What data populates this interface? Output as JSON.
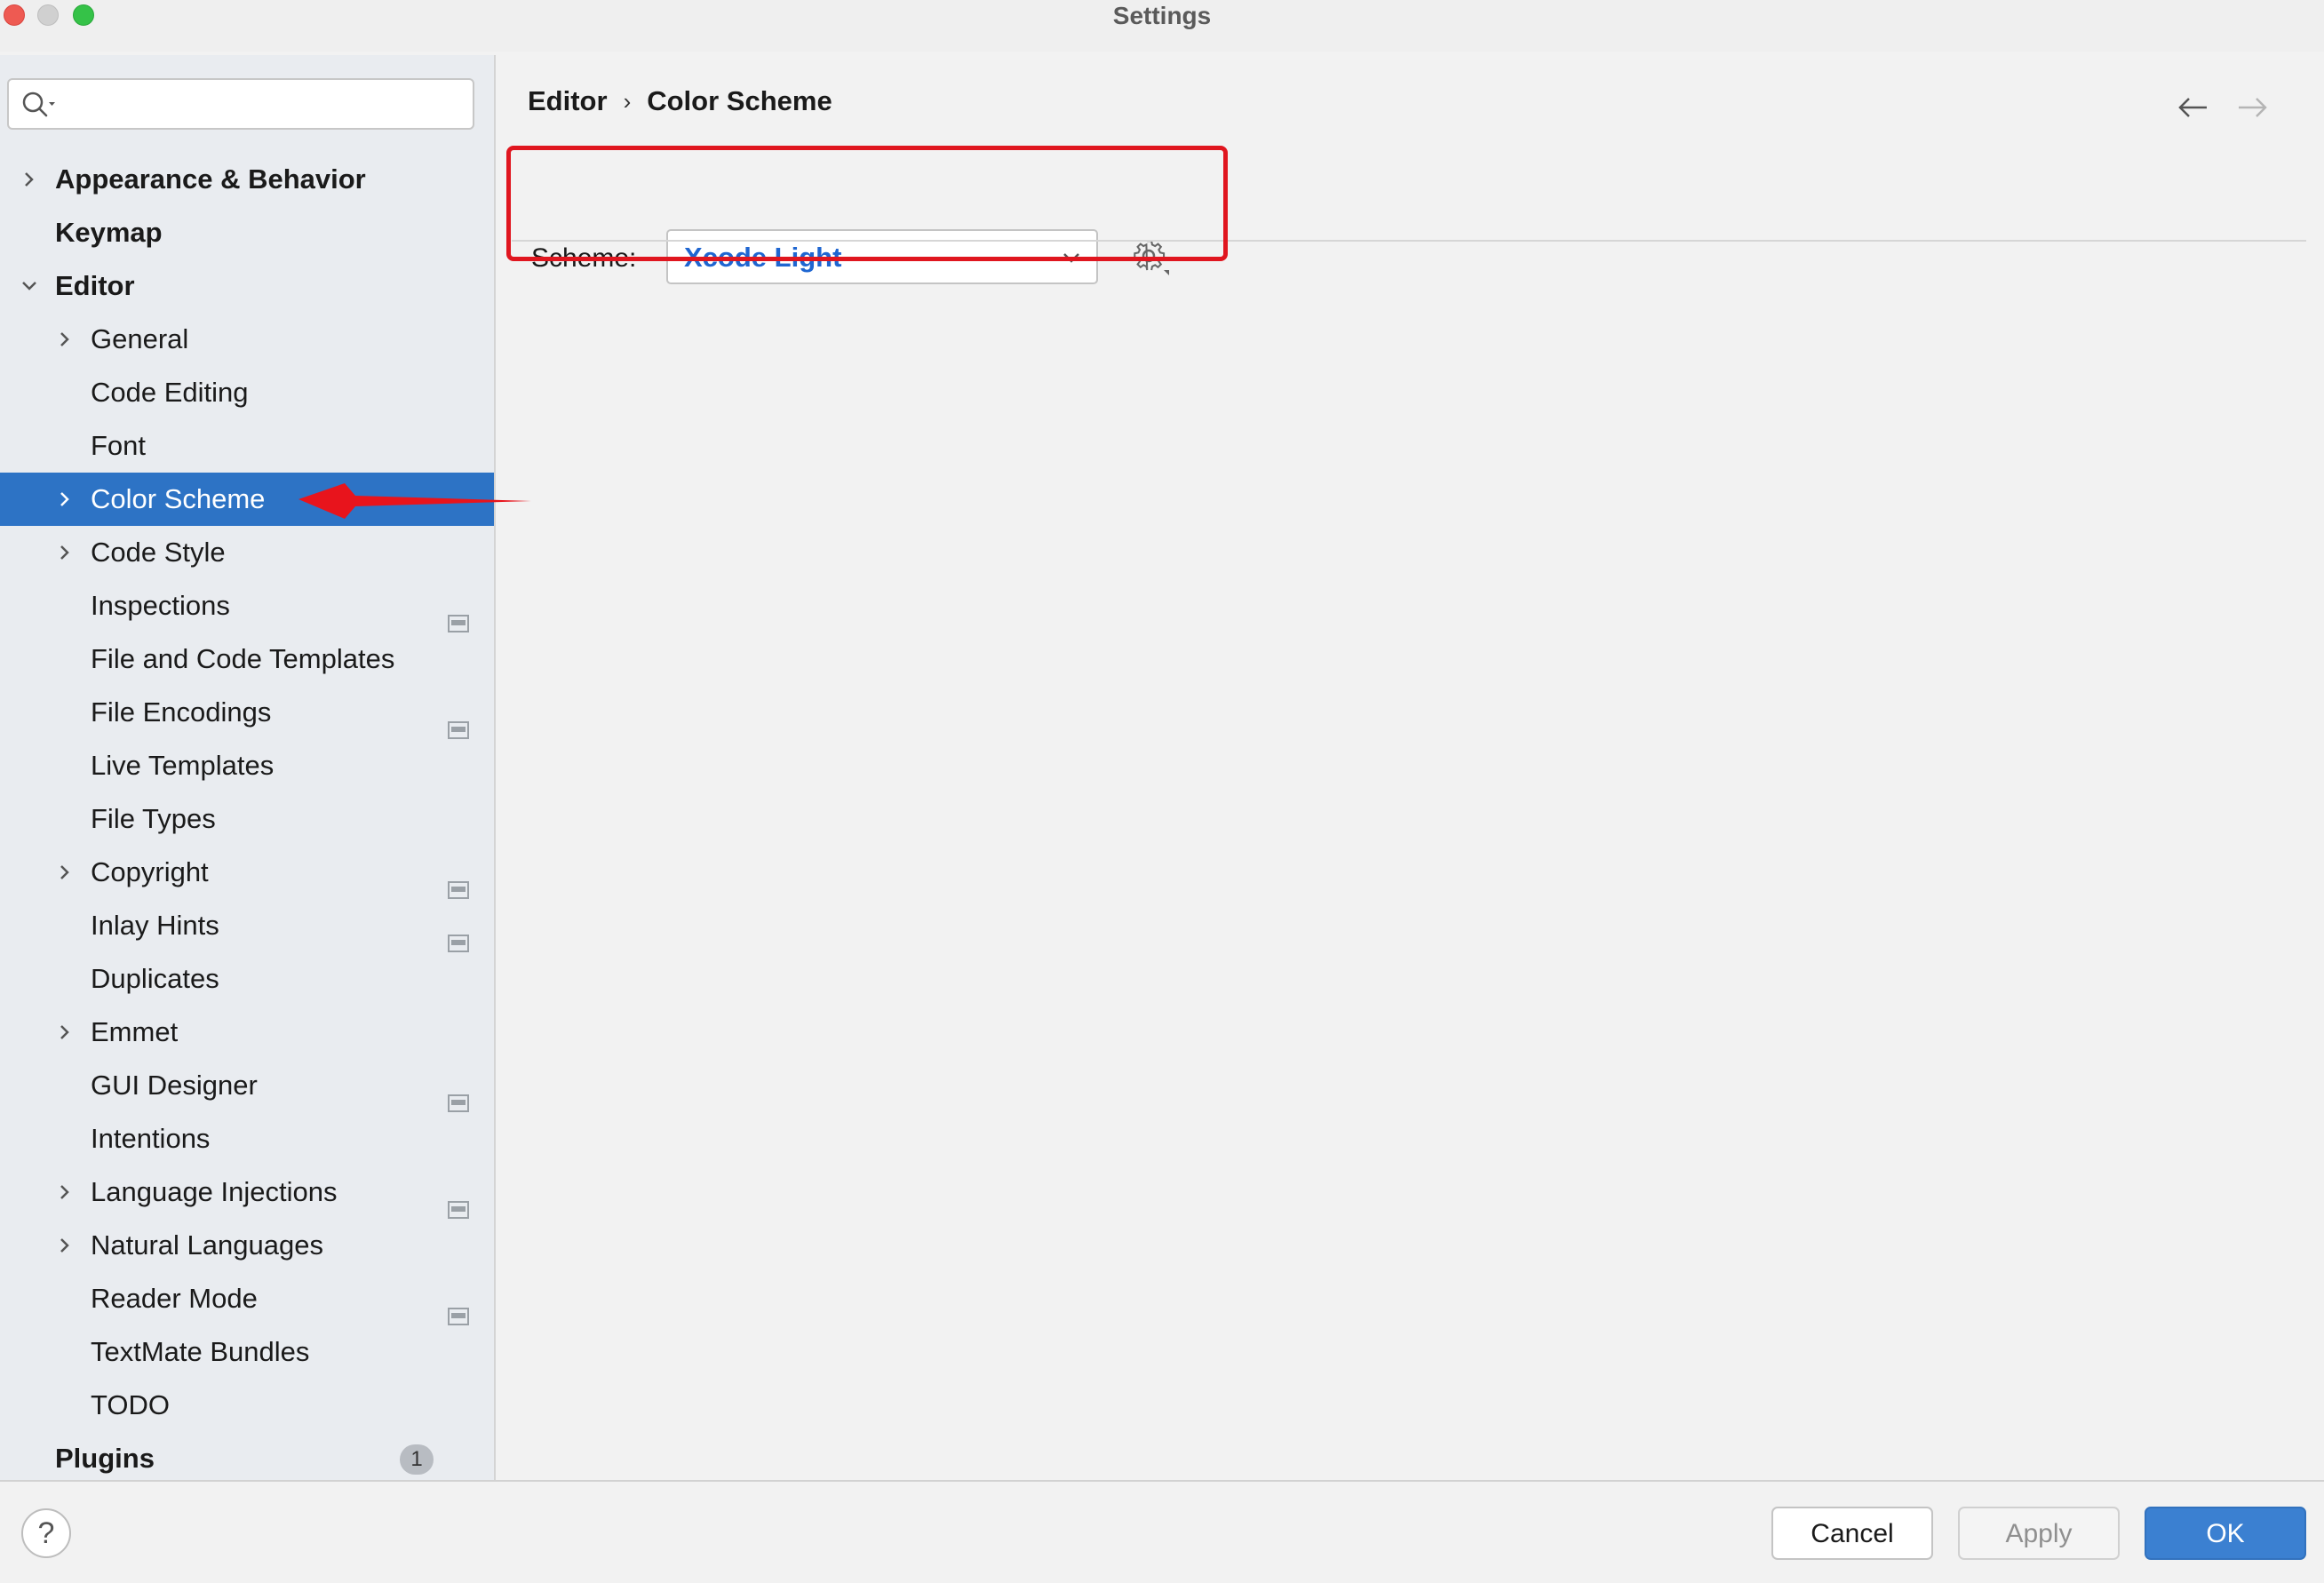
{
  "window": {
    "title": "Settings"
  },
  "search": {
    "placeholder": ""
  },
  "sidebar": {
    "items": [
      {
        "label": "Appearance & Behavior",
        "level": 0,
        "bold": true,
        "chevron": "right",
        "selected": false,
        "badge": null
      },
      {
        "label": "Keymap",
        "level": 0,
        "bold": true,
        "chevron": null,
        "selected": false,
        "badge": null
      },
      {
        "label": "Editor",
        "level": 0,
        "bold": true,
        "chevron": "down",
        "selected": false,
        "badge": null
      },
      {
        "label": "General",
        "level": 1,
        "bold": false,
        "chevron": "right",
        "selected": false,
        "badge": null
      },
      {
        "label": "Code Editing",
        "level": 1,
        "bold": false,
        "chevron": null,
        "selected": false,
        "badge": null
      },
      {
        "label": "Font",
        "level": 1,
        "bold": false,
        "chevron": null,
        "selected": false,
        "badge": null
      },
      {
        "label": "Color Scheme",
        "level": 1,
        "bold": false,
        "chevron": "right",
        "selected": true,
        "badge": null
      },
      {
        "label": "Code Style",
        "level": 1,
        "bold": false,
        "chevron": "right",
        "selected": false,
        "badge": null
      },
      {
        "label": "Inspections",
        "level": 1,
        "bold": false,
        "chevron": null,
        "selected": false,
        "badge": "project-settings-icon"
      },
      {
        "label": "File and Code Templates",
        "level": 1,
        "bold": false,
        "chevron": null,
        "selected": false,
        "badge": null
      },
      {
        "label": "File Encodings",
        "level": 1,
        "bold": false,
        "chevron": null,
        "selected": false,
        "badge": "project-settings-icon"
      },
      {
        "label": "Live Templates",
        "level": 1,
        "bold": false,
        "chevron": null,
        "selected": false,
        "badge": null
      },
      {
        "label": "File Types",
        "level": 1,
        "bold": false,
        "chevron": null,
        "selected": false,
        "badge": null
      },
      {
        "label": "Copyright",
        "level": 1,
        "bold": false,
        "chevron": "right",
        "selected": false,
        "badge": "project-settings-icon"
      },
      {
        "label": "Inlay Hints",
        "level": 1,
        "bold": false,
        "chevron": null,
        "selected": false,
        "badge": "project-settings-icon"
      },
      {
        "label": "Duplicates",
        "level": 1,
        "bold": false,
        "chevron": null,
        "selected": false,
        "badge": null
      },
      {
        "label": "Emmet",
        "level": 1,
        "bold": false,
        "chevron": "right",
        "selected": false,
        "badge": null
      },
      {
        "label": "GUI Designer",
        "level": 1,
        "bold": false,
        "chevron": null,
        "selected": false,
        "badge": "project-settings-icon"
      },
      {
        "label": "Intentions",
        "level": 1,
        "bold": false,
        "chevron": null,
        "selected": false,
        "badge": null
      },
      {
        "label": "Language Injections",
        "level": 1,
        "bold": false,
        "chevron": "right",
        "selected": false,
        "badge": "project-settings-icon"
      },
      {
        "label": "Natural Languages",
        "level": 1,
        "bold": false,
        "chevron": "right",
        "selected": false,
        "badge": null
      },
      {
        "label": "Reader Mode",
        "level": 1,
        "bold": false,
        "chevron": null,
        "selected": false,
        "badge": "project-settings-icon"
      },
      {
        "label": "TextMate Bundles",
        "level": 1,
        "bold": false,
        "chevron": null,
        "selected": false,
        "badge": null
      },
      {
        "label": "TODO",
        "level": 1,
        "bold": false,
        "chevron": null,
        "selected": false,
        "badge": null
      },
      {
        "label": "Plugins",
        "level": 0,
        "bold": true,
        "chevron": null,
        "selected": false,
        "badge": "count",
        "count": "1"
      }
    ]
  },
  "main": {
    "breadcrumb": [
      "Editor",
      "Color Scheme"
    ],
    "scheme": {
      "label": "Scheme:",
      "value": "Xcode Light"
    }
  },
  "footer": {
    "help_label": "?",
    "cancel_label": "Cancel",
    "apply_label": "Apply",
    "ok_label": "OK"
  },
  "colors": {
    "selection": "#2d73c5",
    "scheme_value": "#1f66d1",
    "annotation": "#e0161f",
    "ok_button": "#3b80d1"
  }
}
